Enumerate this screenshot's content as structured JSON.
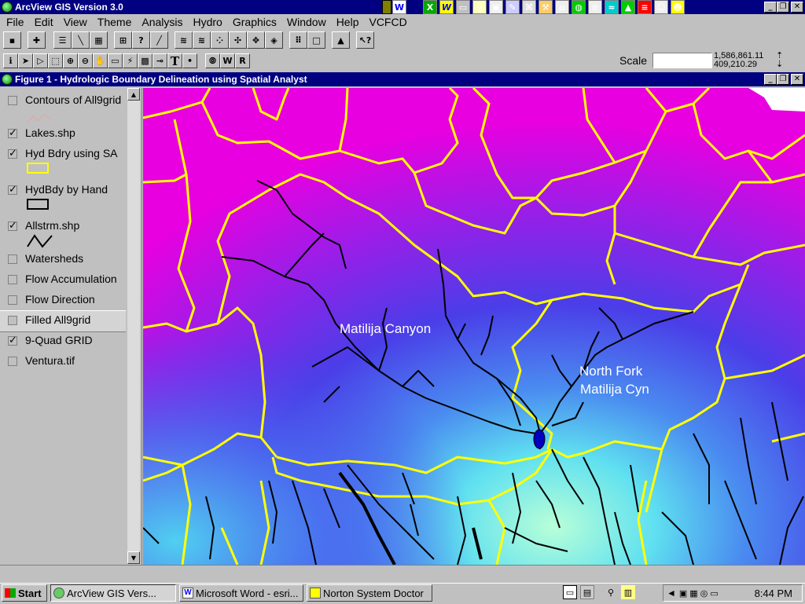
{
  "app": {
    "title": "ArcView GIS Version 3.0"
  },
  "menu": [
    "File",
    "Edit",
    "View",
    "Theme",
    "Analysis",
    "Hydro",
    "Graphics",
    "Window",
    "Help",
    "VCFCD"
  ],
  "scale": {
    "label": "Scale",
    "value": "",
    "coord_x": "1,586,861.11",
    "coord_y": "409,210.29"
  },
  "view": {
    "title": "Figure 1 - Hydrologic Boundary Delineation using Spatial Analyst"
  },
  "legend": [
    {
      "name": "Contours of All9grid",
      "checked": false
    },
    {
      "name": "Lakes.shp",
      "checked": true
    },
    {
      "name": "Hyd Bdry using SA",
      "checked": true
    },
    {
      "name": "HydBdy by Hand",
      "checked": true
    },
    {
      "name": "Allstrm.shp",
      "checked": true
    },
    {
      "name": "Watersheds",
      "checked": false
    },
    {
      "name": "Flow Accumulation",
      "checked": false
    },
    {
      "name": "Flow Direction",
      "checked": false
    },
    {
      "name": "Filled All9grid",
      "checked": false
    },
    {
      "name": "9-Quad GRID",
      "checked": true
    },
    {
      "name": "Ventura.tif",
      "checked": false
    }
  ],
  "map_labels": {
    "matilija": "Matilija Canyon",
    "north_fork_1": "North Fork",
    "north_fork_2": "Matilija Cyn"
  },
  "taskbar": {
    "start": "Start",
    "tasks": [
      "ArcView GIS Vers...",
      "Microsoft Word - esri...",
      "Norton System Doctor"
    ],
    "clock": "8:44 PM"
  },
  "colors": {
    "titlebar": "#000080",
    "face": "#c0c0c0",
    "boundary": "#ffff00",
    "stream": "#000000"
  }
}
